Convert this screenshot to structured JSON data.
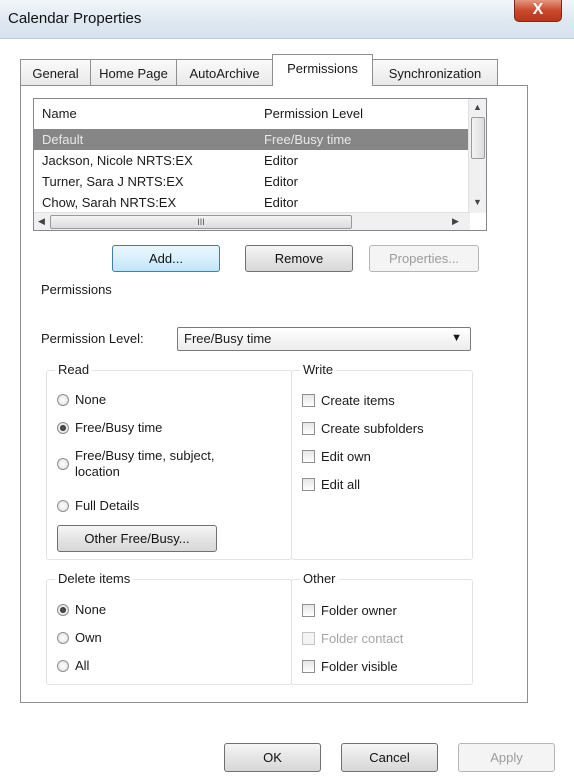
{
  "window": {
    "title": "Calendar Properties",
    "close_glyph": "X"
  },
  "tabs": [
    {
      "label": "General"
    },
    {
      "label": "Home Page"
    },
    {
      "label": "AutoArchive"
    },
    {
      "label": "Permissions"
    },
    {
      "label": "Synchronization"
    }
  ],
  "list": {
    "columns": [
      "Name",
      "Permission Level"
    ],
    "rows": [
      {
        "name": "Default",
        "level": "Free/Busy time"
      },
      {
        "name": "Jackson, Nicole NRTS:EX",
        "level": "Editor"
      },
      {
        "name": "Turner, Sara J NRTS:EX",
        "level": "Editor"
      },
      {
        "name": "Chow, Sarah NRTS:EX",
        "level": "Editor"
      }
    ],
    "scroll_grip": "III"
  },
  "buttons": {
    "add": "Add...",
    "remove": "Remove",
    "properties": "Properties..."
  },
  "permissions": {
    "section_label": "Permissions",
    "level_label": "Permission Level:",
    "level_value": "Free/Busy time",
    "read": {
      "title": "Read",
      "options": [
        "None",
        "Free/Busy time",
        "Free/Busy time, subject, location",
        "Full Details"
      ],
      "selected": 1,
      "other_button": "Other Free/Busy..."
    },
    "write": {
      "title": "Write",
      "options": [
        "Create items",
        "Create subfolders",
        "Edit own",
        "Edit all"
      ]
    },
    "delete": {
      "title": "Delete items",
      "options": [
        "None",
        "Own",
        "All"
      ],
      "selected": 0
    },
    "other": {
      "title": "Other",
      "options": [
        "Folder owner",
        "Folder contact",
        "Folder visible"
      ]
    }
  },
  "footer": {
    "ok": "OK",
    "cancel": "Cancel",
    "apply": "Apply"
  }
}
